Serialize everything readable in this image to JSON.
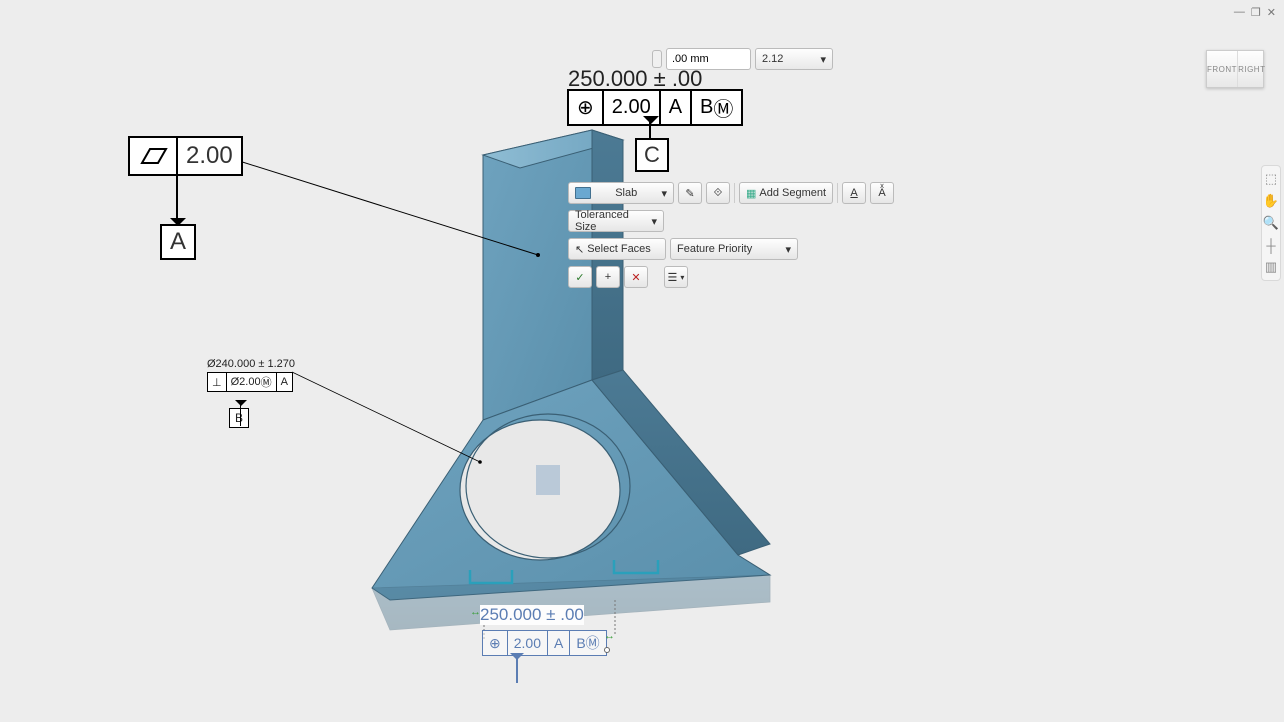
{
  "window": {
    "minimize": "—",
    "maximize": "❐",
    "close": "✕"
  },
  "viewcube": {
    "front": "FRONT",
    "right": "RIGHT"
  },
  "right_toolbar": {
    "fit": "⬚",
    "hand": "✋",
    "zoom": "🔍",
    "axis": "┼",
    "section": "▥"
  },
  "tol_bar": {
    "value": ".00 mm",
    "scale": "2.12"
  },
  "dim_top": "250.000 ± .00",
  "fcf_top": {
    "sym": "⊕",
    "tol": "2.00",
    "a": "A",
    "b": "B",
    "m": "Ⓜ"
  },
  "datum_c": "C",
  "fcf_flat": {
    "tol": "2.00"
  },
  "datum_a": "A",
  "mid": {
    "diam": "Ø240.000 ± 1.270",
    "perp": "⊥",
    "diam2": "Ø2.00",
    "m": "Ⓜ",
    "a": "A"
  },
  "datum_b": "B",
  "ctx": {
    "slab": "Slab",
    "chev": "▾",
    "add_segment": "Add Segment",
    "tol_size": "Toleranced Size",
    "select_faces": "Select Faces",
    "feature_priority": "Feature Priority",
    "ok": "✓",
    "add": "+",
    "cancel": "✕"
  },
  "bottom": {
    "dim": "250.000 ± .00",
    "sym": "⊕",
    "tol": "2.00",
    "a": "A",
    "b": "B",
    "m": "Ⓜ"
  },
  "ext_arrow_l": "↔",
  "ext_arrow_r": "↔"
}
